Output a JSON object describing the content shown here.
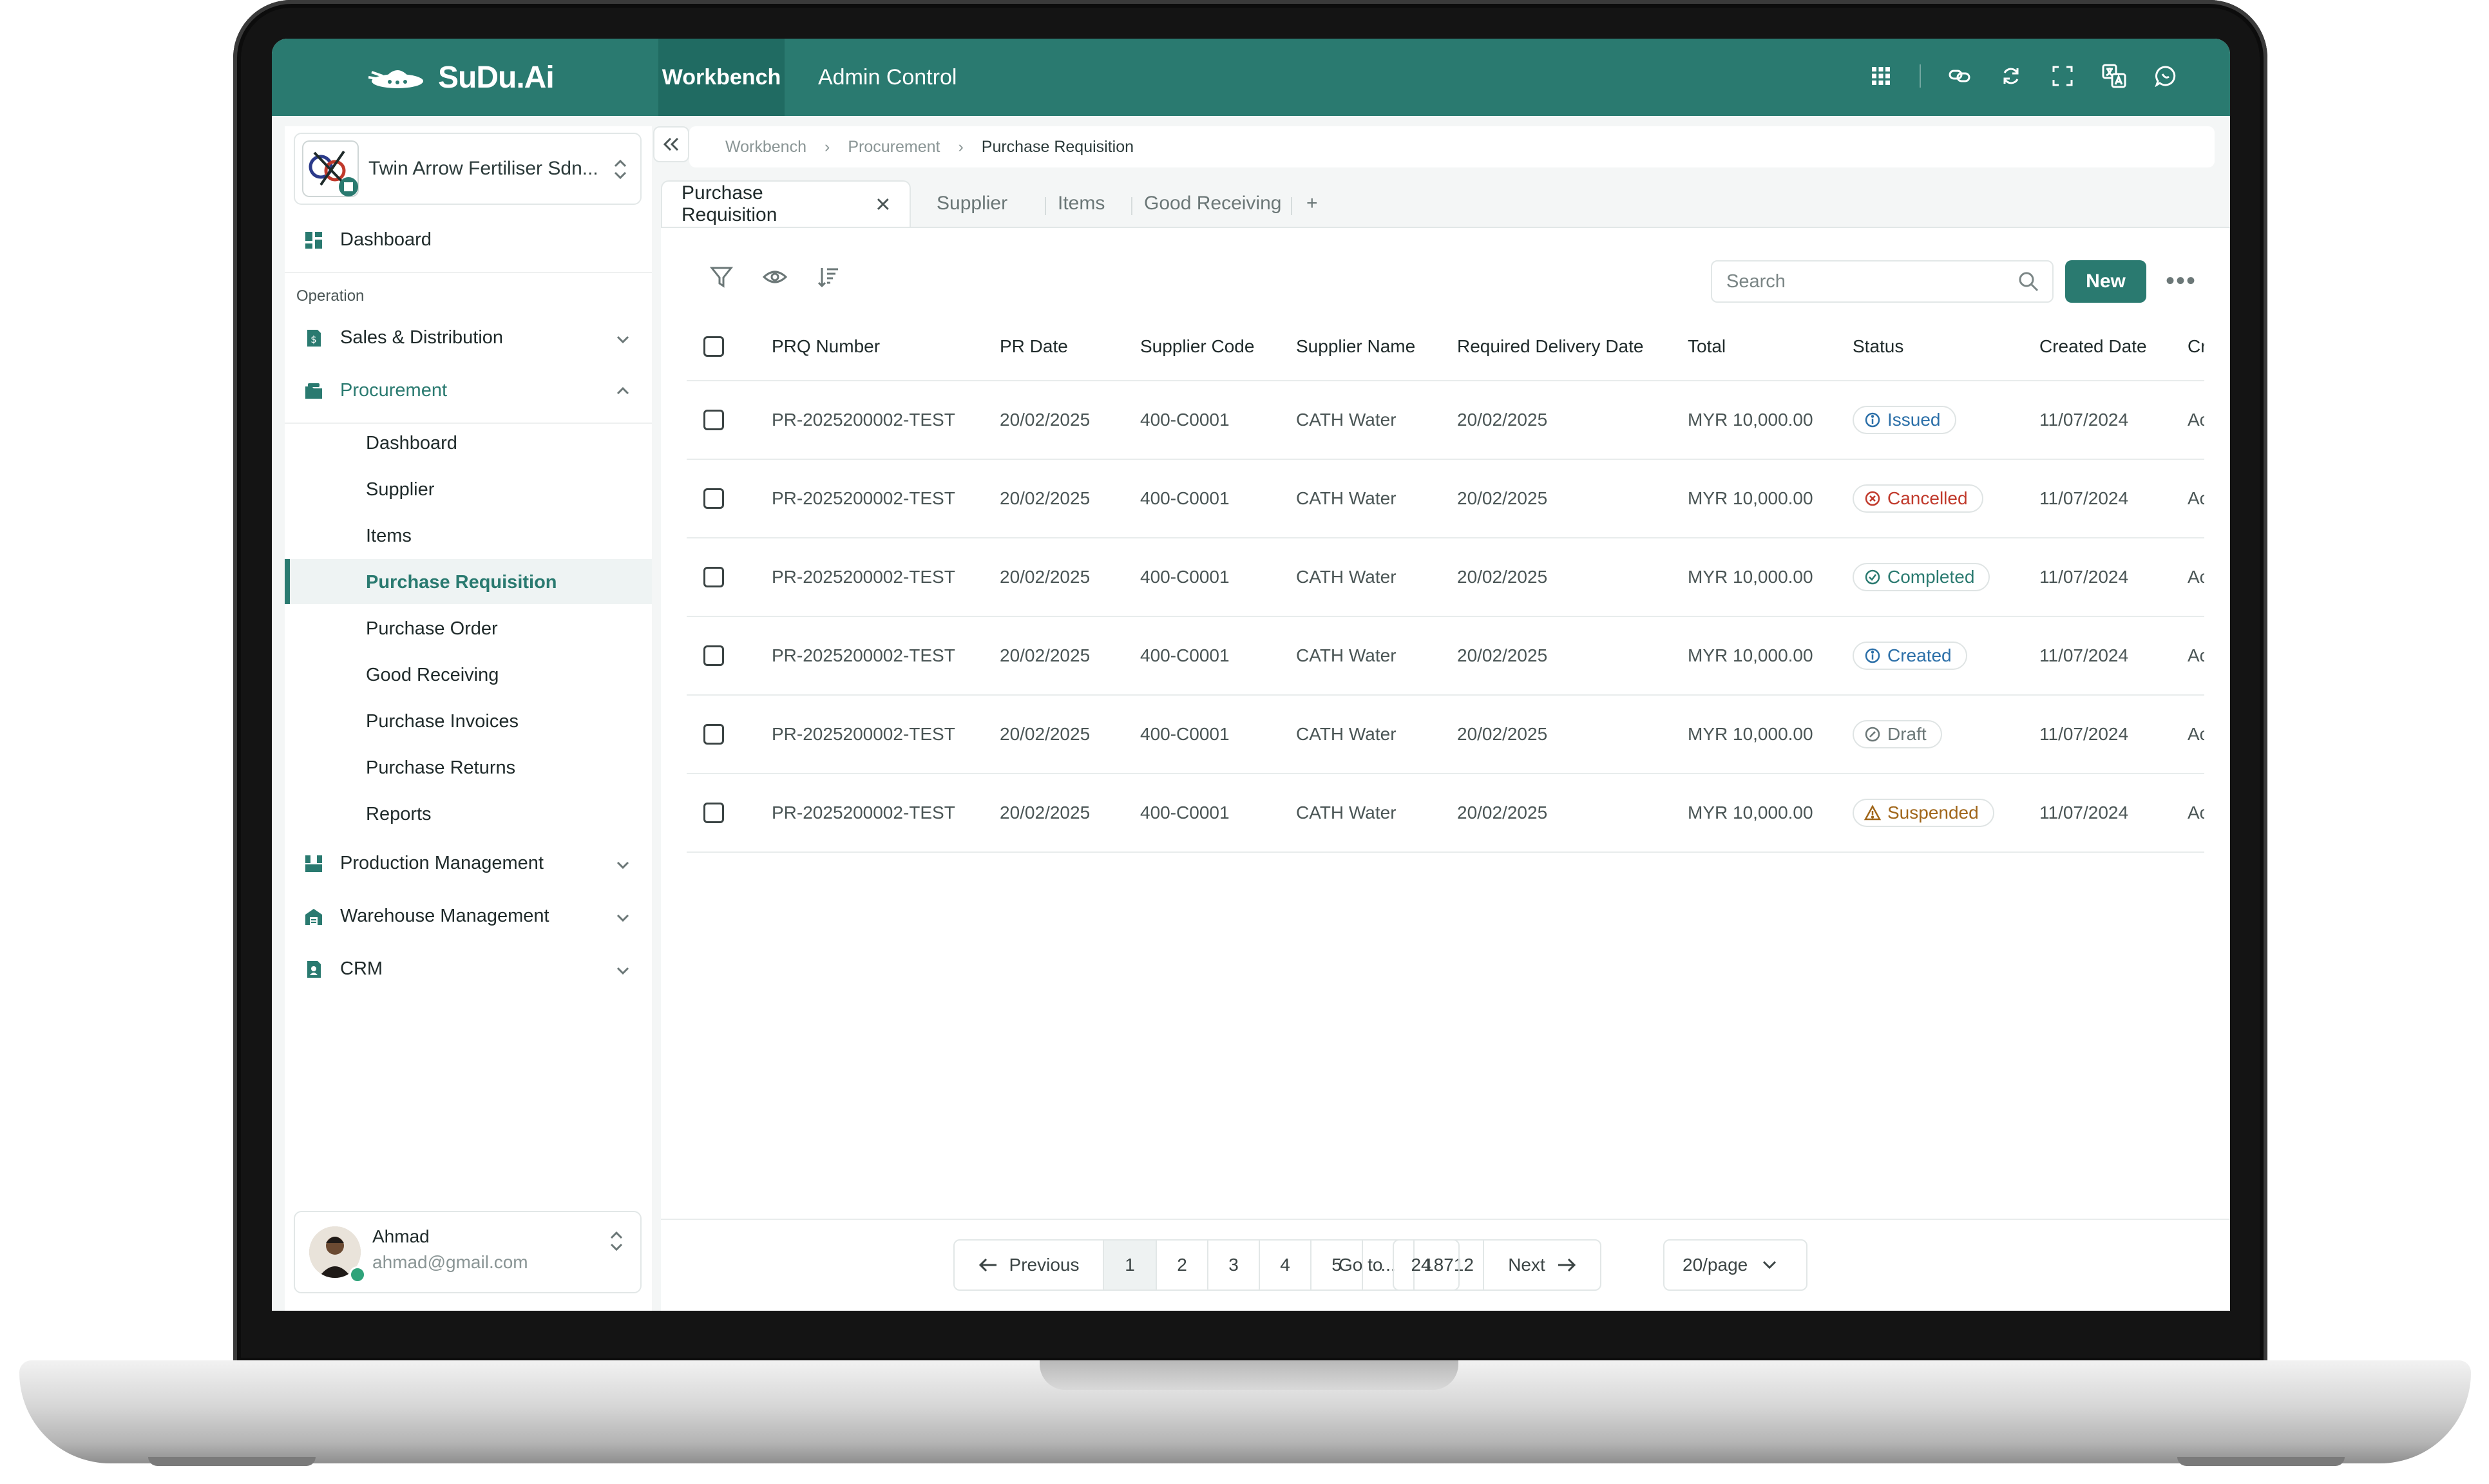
{
  "app": {
    "brand": "SuDu.Ai",
    "top_tabs": [
      "Workbench",
      "Admin Control"
    ],
    "top_icons": [
      "apps-grid-icon",
      "link-icon",
      "sync-icon",
      "fullscreen-icon",
      "translate-icon",
      "chat-icon"
    ],
    "accent_color": "#2a7a70"
  },
  "sidebar": {
    "company": "Twin Arrow Fertiliser Sdn...",
    "dashboard": "Dashboard",
    "section": "Operation",
    "groups": [
      {
        "label": "Sales & Distribution",
        "icon": "sales-icon"
      },
      {
        "label": "Procurement",
        "icon": "procurement-icon"
      },
      {
        "label": "Production Management",
        "icon": "production-icon"
      },
      {
        "label": "Warehouse Management",
        "icon": "warehouse-icon"
      },
      {
        "label": "CRM",
        "icon": "crm-icon"
      }
    ],
    "procurement_items": [
      "Dashboard",
      "Supplier",
      "Items",
      "Purchase Requisition",
      "Purchase Order",
      "Good Receiving",
      "Purchase Invoices",
      "Purchase Returns",
      "Reports"
    ],
    "active_item": "Purchase Requisition",
    "user": {
      "name": "Ahmad",
      "email": "ahmad@gmail.com"
    }
  },
  "breadcrumb": [
    "Workbench",
    "Procurement",
    "Purchase Requisition"
  ],
  "tabs": [
    "Purchase Requisition",
    "Supplier",
    "Items",
    "Good Receiving",
    "+"
  ],
  "toolbar": {
    "search_placeholder": "Search",
    "new_label": "New"
  },
  "table": {
    "columns": [
      "PRQ Number",
      "PR Date",
      "Supplier Code",
      "Supplier Name",
      "Required Delivery Date",
      "Total",
      "Status",
      "Created Date",
      "Cr"
    ],
    "rows": [
      {
        "prq": "PR-2025200002-TEST",
        "pr_date": "20/02/2025",
        "supplier_code": "400-C0001",
        "supplier_name": "CATH Water",
        "delivery": "20/02/2025",
        "total": "MYR 10,000.00",
        "status": "Issued",
        "created": "11/07/2024",
        "extra": "Ac"
      },
      {
        "prq": "PR-2025200002-TEST",
        "pr_date": "20/02/2025",
        "supplier_code": "400-C0001",
        "supplier_name": "CATH Water",
        "delivery": "20/02/2025",
        "total": "MYR 10,000.00",
        "status": "Cancelled",
        "created": "11/07/2024",
        "extra": "Ac"
      },
      {
        "prq": "PR-2025200002-TEST",
        "pr_date": "20/02/2025",
        "supplier_code": "400-C0001",
        "supplier_name": "CATH Water",
        "delivery": "20/02/2025",
        "total": "MYR 10,000.00",
        "status": "Completed",
        "created": "11/07/2024",
        "extra": "Ac"
      },
      {
        "prq": "PR-2025200002-TEST",
        "pr_date": "20/02/2025",
        "supplier_code": "400-C0001",
        "supplier_name": "CATH Water",
        "delivery": "20/02/2025",
        "total": "MYR 10,000.00",
        "status": "Created",
        "created": "11/07/2024",
        "extra": "Ac"
      },
      {
        "prq": "PR-2025200002-TEST",
        "pr_date": "20/02/2025",
        "supplier_code": "400-C0001",
        "supplier_name": "CATH Water",
        "delivery": "20/02/2025",
        "total": "MYR 10,000.00",
        "status": "Draft",
        "created": "11/07/2024",
        "extra": "Ac"
      },
      {
        "prq": "PR-2025200002-TEST",
        "pr_date": "20/02/2025",
        "supplier_code": "400-C0001",
        "supplier_name": "CATH Water",
        "delivery": "20/02/2025",
        "total": "MYR 10,000.00",
        "status": "Suspended",
        "created": "11/07/2024",
        "extra": "Ac"
      }
    ],
    "status_colors": {
      "Issued": "#2b6fa8",
      "Cancelled": "#c0392b",
      "Completed": "#2a7a70",
      "Created": "#2b6fa8",
      "Draft": "#6b7777",
      "Suspended": "#a0661a"
    }
  },
  "pagination": {
    "previous": "Previous",
    "pages": [
      "1",
      "2",
      "3",
      "4",
      "5",
      "...",
      "18712"
    ],
    "next": "Next",
    "goto_label": "Go to",
    "goto_value": "24",
    "per_page": "20/page"
  }
}
